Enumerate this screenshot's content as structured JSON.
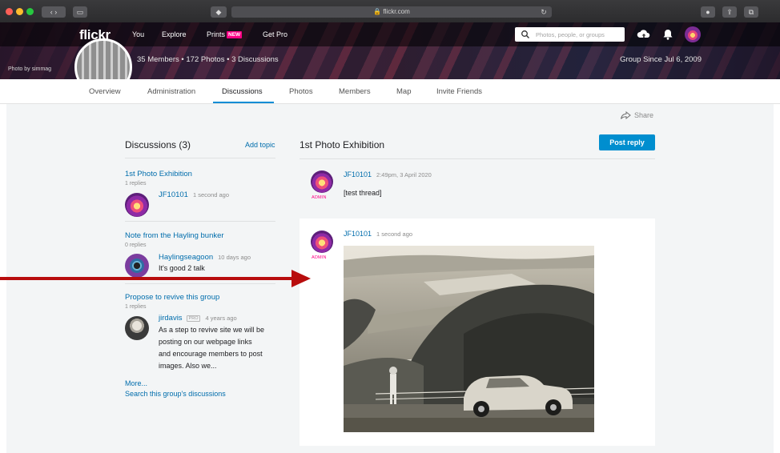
{
  "browser": {
    "url": "flickr.com"
  },
  "header": {
    "logo": "flickr",
    "nav": {
      "you": "You",
      "explore": "Explore",
      "prints": "Prints",
      "prints_badge": "NEW",
      "get_pro": "Get Pro"
    },
    "search_placeholder": "Photos, people, or groups",
    "icons": [
      "upload-cloud-icon",
      "notification-bell-icon",
      "user-avatar"
    ]
  },
  "group": {
    "stats": "35 Members  •  172 Photos  •  3 Discussions",
    "since": "Group Since Jul 6, 2009",
    "photo_credit": "Photo by simmag"
  },
  "subnav": {
    "tabs": [
      "Overview",
      "Administration",
      "Discussions",
      "Photos",
      "Members",
      "Map",
      "Invite Friends"
    ],
    "active": "Discussions"
  },
  "share_label": "Share",
  "discussions": {
    "title": "Discussions (3)",
    "add_topic": "Add topic",
    "threads": [
      {
        "title": "1st Photo Exhibition",
        "replies": "1 replies",
        "user": "JF10101",
        "time": "1 second ago",
        "text": ""
      },
      {
        "title": "Note from the Hayling bunker",
        "replies": "0 replies",
        "user": "Haylingseagoon",
        "time": "10 days ago",
        "text": "It's good 2 talk"
      },
      {
        "title": "Propose to revive this group",
        "replies": "1 replies",
        "user": "jirdavis",
        "pro": "PRO",
        "time": "4 years ago",
        "text_lines": [
          "As a step to revive site we will be",
          "posting on our webpage links",
          "and encourage members to post",
          "images. Also we..."
        ]
      }
    ],
    "more": "More...",
    "search_link": "Search this group's discussions"
  },
  "topic": {
    "title": "1st Photo Exhibition",
    "post_reply": "Post reply",
    "posts": [
      {
        "user": "JF10101",
        "time": "2:49pm, 3 April 2020",
        "role": "ADMIN",
        "text": "[test thread]"
      },
      {
        "user": "JF10101",
        "time": "1 second ago",
        "role": "ADMIN",
        "image": "vintage-car-landscape-photo"
      }
    ]
  },
  "colors": {
    "link": "#006dac",
    "accent": "#008ecf",
    "admin": "#ff0084",
    "annotation_arrow": "#b80d0d"
  }
}
